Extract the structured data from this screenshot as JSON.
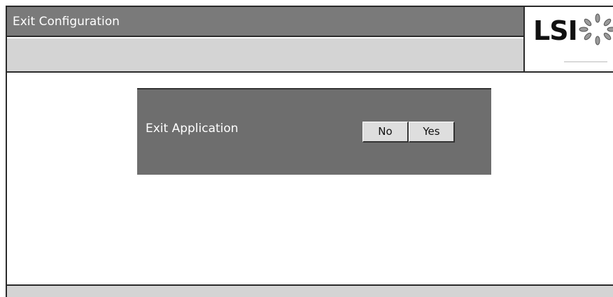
{
  "window": {
    "title": "Exit Configuration"
  },
  "logo": {
    "text": "LSI",
    "icon": "starburst-logo-mark"
  },
  "dialog": {
    "label": "Exit Application",
    "no_label": "No",
    "yes_label": "Yes"
  },
  "colors": {
    "title_bar": "#7a7a7a",
    "sub_bar": "#d4d4d4",
    "dialog_bg": "#6e6e6e",
    "button_bg": "#dedede"
  }
}
